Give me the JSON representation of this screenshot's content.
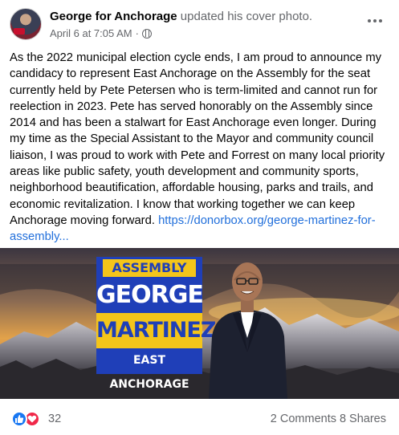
{
  "post": {
    "author": "George for Anchorage",
    "action": " updated his cover photo.",
    "timestamp": "April 6 at 7:05 AM",
    "separator": "·",
    "privacy_icon": "globe-icon",
    "more_icon": "more-options-icon",
    "body": "As the 2022 municipal election cycle ends, I am proud to announce my candidacy to represent East Anchorage on the Assembly for the seat currently held by Pete Petersen who is term-limited and cannot run for reelection in 2023. Pete has served honorably on the Assembly since 2014 and has been a stalwart for East Anchorage even longer. During my time as the Special Assistant to the Mayor and community council liaison, I was proud to work with Pete and Forrest on many local priority areas like public safety, youth development and community sports, neighborhood beautification, affordable housing, parks and trails, and economic revitalization.  I know that working together we can keep Anchorage moving forward. ",
    "link": "https://donorbox.org/george-martinez-for-assembly..."
  },
  "cover": {
    "line1": "ASSEMBLY",
    "line2": "GEORGE",
    "line3": "MARTINEZ",
    "line4": "EAST ANCHORAGE"
  },
  "reactions": {
    "icons": [
      "like-icon",
      "love-icon"
    ],
    "count": "32",
    "comments": "2 Comments",
    "shares": "8 Shares"
  },
  "colors": {
    "link": "#216fdb",
    "like": "#1877f2",
    "love": "#f02849",
    "sign_blue": "#1f3fb8",
    "sign_yellow": "#f4c51a"
  }
}
